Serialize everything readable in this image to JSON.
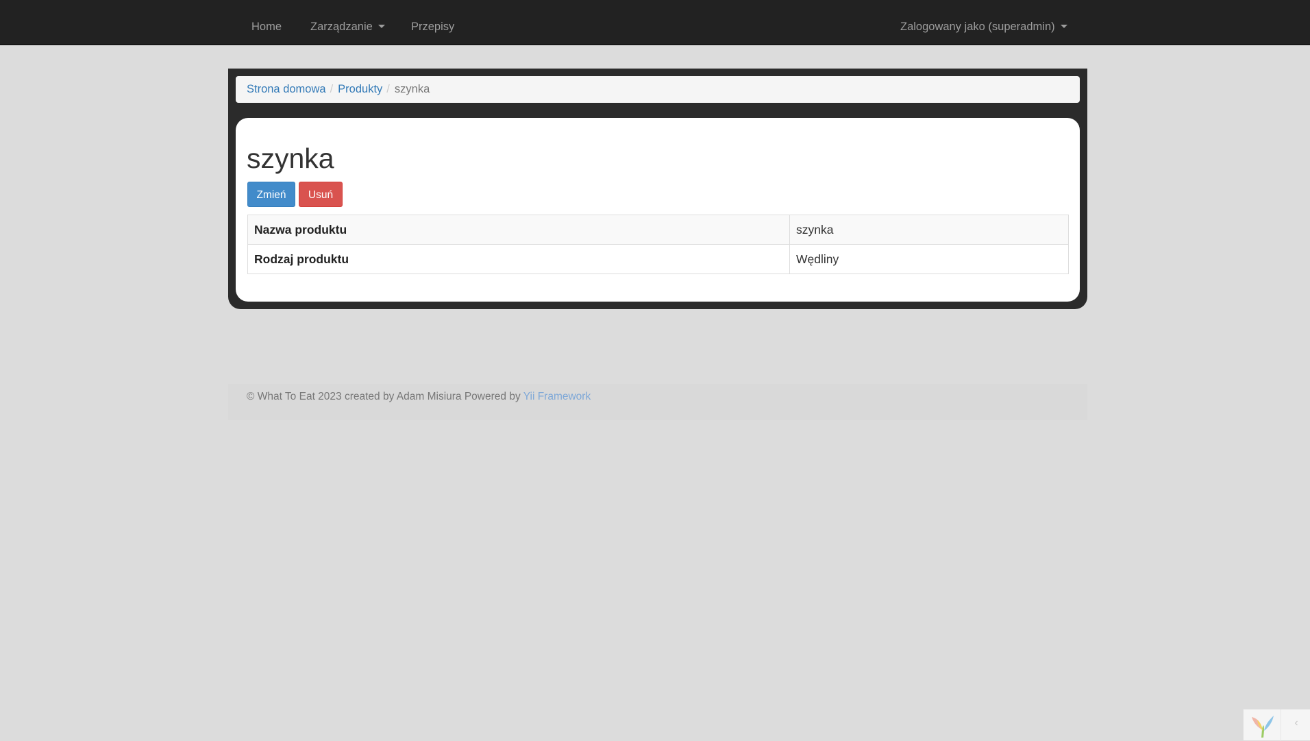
{
  "navbar": {
    "items": [
      {
        "label": "Home"
      },
      {
        "label": "Zarządzanie"
      },
      {
        "label": "Przepisy"
      }
    ],
    "user_menu": "Zalogowany jako (superadmin)"
  },
  "breadcrumb": {
    "home": "Strona domowa",
    "products": "Produkty",
    "current": "szynka",
    "separator": "/"
  },
  "page": {
    "title": "szynka",
    "buttons": {
      "edit": "Zmień",
      "delete": "Usuń"
    }
  },
  "details": [
    {
      "label": "Nazwa produktu",
      "value": "szynka"
    },
    {
      "label": "Rodzaj produktu",
      "value": "Wędliny"
    }
  ],
  "footer": {
    "text": "© What To Eat 2023 created by Adam Misiura Powered by ",
    "link": "Yii Framework"
  },
  "debug_toolbar": {
    "logo_icon": "yii-logo-icon",
    "toggle_glyph": "‹"
  },
  "colors": {
    "navbar": "#222222",
    "primary": "#428bca",
    "danger": "#d9534f",
    "link": "#337ab7"
  }
}
